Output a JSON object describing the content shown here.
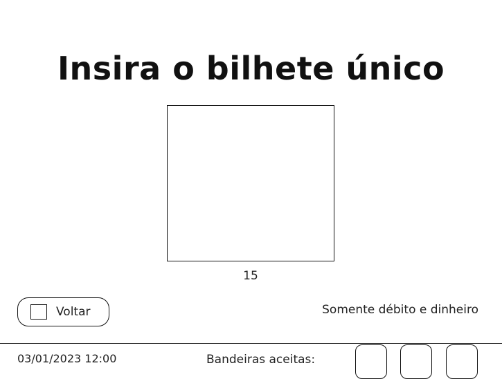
{
  "screen": {
    "title": "Insira o bilhete único",
    "countdown": "15"
  },
  "actions": {
    "back_label": "Voltar",
    "back_icon": "square-icon"
  },
  "info": {
    "payment_note": "Somente débito e dinheiro"
  },
  "footer": {
    "datetime": "03/01/2023 12:00",
    "brands_label": "Bandeiras aceitas:"
  },
  "colors": {
    "ink": "#111111",
    "background": "#ffffff"
  }
}
